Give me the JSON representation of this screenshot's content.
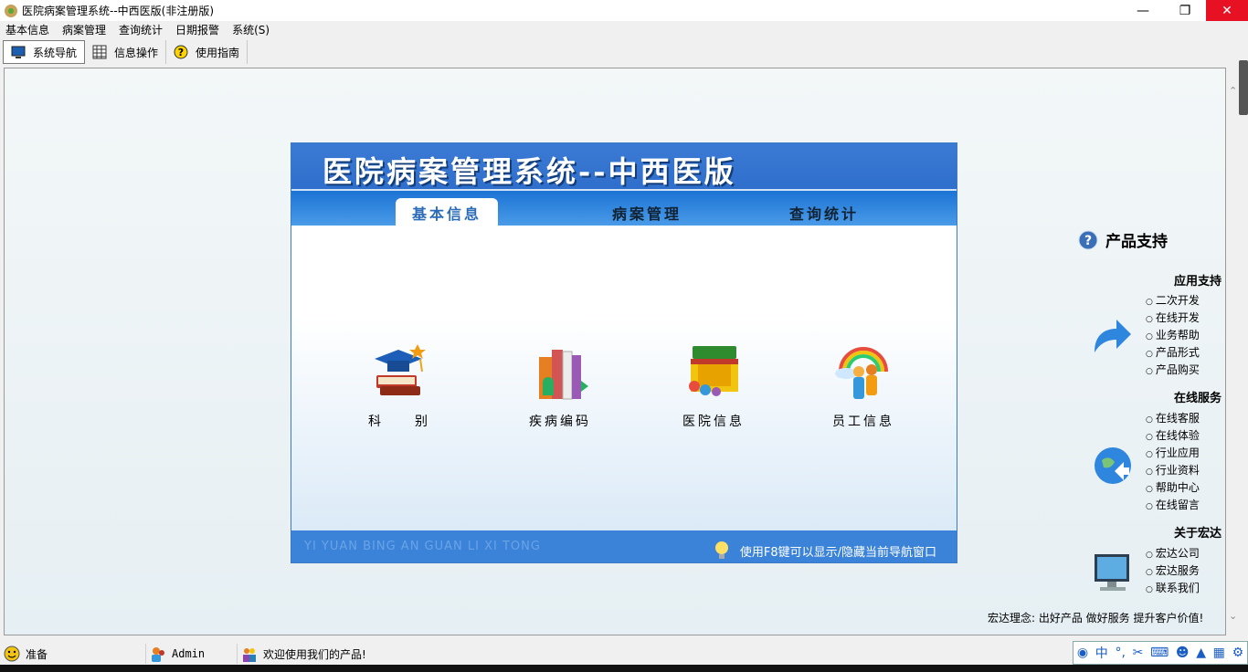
{
  "window": {
    "title": "医院病案管理系统--中西医版(非注册版)"
  },
  "menu": [
    "基本信息",
    "病案管理",
    "查询统计",
    "日期报警",
    "系统(S)"
  ],
  "toolbar": [
    {
      "label": "系统导航",
      "icon": "monitor-icon"
    },
    {
      "label": "信息操作",
      "icon": "grid-icon"
    },
    {
      "label": "使用指南",
      "icon": "help-icon"
    }
  ],
  "panel": {
    "title": "医院病案管理系统--中西医版",
    "tabs": [
      "基本信息",
      "病案管理",
      "查询统计"
    ],
    "items": [
      {
        "label": "科　　别",
        "icon": "graduation-cap-icon"
      },
      {
        "label": "疾病编码",
        "icon": "books-icon"
      },
      {
        "label": "医院信息",
        "icon": "shop-icon"
      },
      {
        "label": "员工信息",
        "icon": "staff-icon"
      }
    ],
    "footer_left": "YI YUAN BING AN GUAN LI XI TONG",
    "footer_right": "使用F8键可以显示/隐藏当前导航窗口"
  },
  "support": {
    "title": "产品支持",
    "sections": [
      {
        "title": "应用支持",
        "icon": "arrow-icon",
        "items": [
          "二次开发",
          "在线开发",
          "业务帮助",
          "产品形式",
          "产品购买"
        ]
      },
      {
        "title": "在线服务",
        "icon": "globe-icon",
        "items": [
          "在线客服",
          "在线体验",
          "行业应用",
          "行业资料",
          "帮助中心",
          "在线留言"
        ]
      },
      {
        "title": "关于宏达",
        "icon": "monitor-icon",
        "items": [
          "宏达公司",
          "宏达服务",
          "联系我们"
        ]
      }
    ],
    "slogan": "宏达理念: 出好产品  做好服务  提升客户价值!"
  },
  "status": {
    "ready": "准备",
    "user": "Admin",
    "welcome": "欢迎使用我们的产品!"
  },
  "ime": {
    "label": "中"
  }
}
